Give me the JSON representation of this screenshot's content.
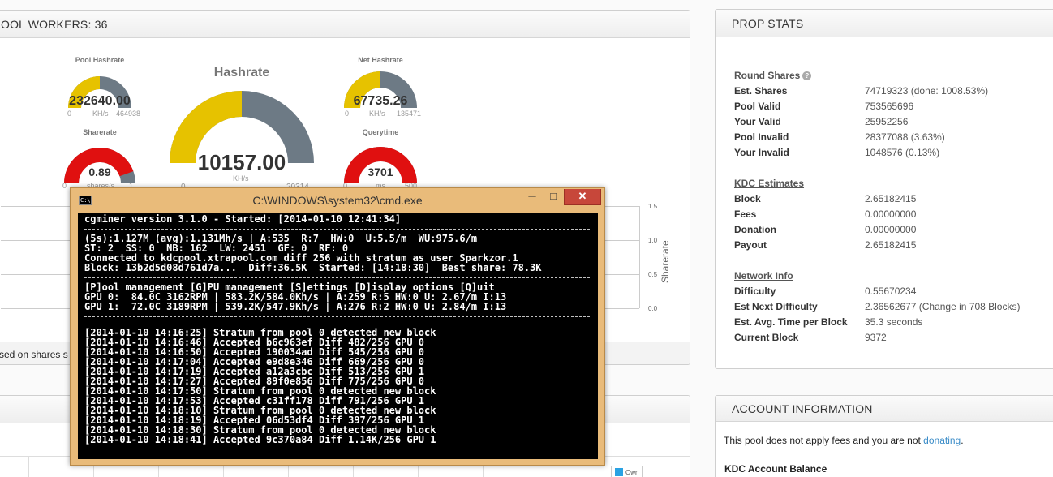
{
  "workers_panel": {
    "title": "OOL WORKERS: 36",
    "footer_text": "sed on shares s"
  },
  "gauges": {
    "pool_hashrate": {
      "title": "Pool Hashrate",
      "value": "232640.00",
      "min": "0",
      "unit": "KH/s",
      "max": "464938",
      "fraction": 0.5
    },
    "hashrate": {
      "title": "Hashrate",
      "value": "10157.00",
      "min": "0",
      "unit": "KH/s",
      "max": "20314",
      "fraction": 0.5
    },
    "net_hashrate": {
      "title": "Net Hashrate",
      "value": "67735.26",
      "min": "0",
      "unit": "KH/s",
      "max": "135471",
      "fraction": 0.5
    },
    "sharerate": {
      "title": "Sharerate",
      "value": "0.89",
      "min": "0",
      "unit": "shares/s",
      "max": "1",
      "fraction": 0.89
    },
    "querytime": {
      "title": "Querytime",
      "value": "3701",
      "min": "0",
      "unit": "ms",
      "max": "500",
      "fraction": 1.0
    }
  },
  "sharerate_chart": {
    "ylabel": "Sharerate",
    "ticks": [
      "1.5",
      "1.0",
      "0.5",
      "0.0"
    ]
  },
  "own_legend": "Own",
  "prop_stats": {
    "title": "PROP STATS",
    "round_shares": {
      "heading": "Round Shares",
      "rows": [
        {
          "label": "Est. Shares",
          "value": "74719323 (done: 1008.53%)"
        },
        {
          "label": "Pool Valid",
          "value": "753565696"
        },
        {
          "label": "Your Valid",
          "value": "25952256"
        },
        {
          "label": "Pool Invalid",
          "value": "28377088 (3.63%)"
        },
        {
          "label": "Your Invalid",
          "value": "1048576 (0.13%)"
        }
      ]
    },
    "kdc_estimates": {
      "heading": "KDC Estimates",
      "rows": [
        {
          "label": "Block",
          "value": "2.65182415"
        },
        {
          "label": "Fees",
          "value": "0.00000000"
        },
        {
          "label": "Donation",
          "value": "0.00000000"
        },
        {
          "label": "Payout",
          "value": "2.65182415"
        }
      ]
    },
    "network_info": {
      "heading": "Network Info",
      "rows": [
        {
          "label": "Difficulty",
          "value": "0.55670234"
        },
        {
          "label": "Est Next Difficulty",
          "value": "2.36562677 (Change in 708 Blocks)"
        },
        {
          "label": "Est. Avg. Time per Block",
          "value": "35.3 seconds"
        },
        {
          "label": "Current Block",
          "value": "9372"
        }
      ]
    }
  },
  "account": {
    "title": "ACCOUNT INFORMATION",
    "fee_text": "This pool does not apply fees and you are not ",
    "fee_link": "donating",
    "fee_end": ".",
    "balance_label": "KDC Account Balance"
  },
  "cmd": {
    "title": "C:\\WINDOWS\\system32\\cmd.exe",
    "header": "cgminer version 3.1.0 - Started: [2014-01-10 12:41:34]",
    "status": [
      "(5s):1.127M (avg):1.131Mh/s | A:535  R:7  HW:0  U:5.5/m  WU:975.6/m",
      "ST: 2  SS: 0  NB: 162  LW: 2451  GF: 0  RF: 0",
      "Connected to kdcpool.xtrapool.com diff 256 with stratum as user Sparkzor.1",
      "Block: 13b2d5d08d761d7a...  Diff:36.5K  Started: [14:18:30]  Best share: 78.3K"
    ],
    "menu": [
      "[P]ool management [G]PU management [S]ettings [D]isplay options [Q]uit",
      "GPU 0:  84.0C 3162RPM | 583.2K/584.0Kh/s | A:259 R:5 HW:0 U: 2.67/m I:13",
      "GPU 1:  72.0C 3189RPM | 539.2K/547.9Kh/s | A:276 R:2 HW:0 U: 2.84/m I:13"
    ],
    "log": [
      "[2014-01-10 14:16:25] Stratum from pool 0 detected new block",
      "[2014-01-10 14:16:46] Accepted b6c963ef Diff 482/256 GPU 0",
      "[2014-01-10 14:16:50] Accepted 190034ad Diff 545/256 GPU 0",
      "[2014-01-10 14:17:04] Accepted e9d8e346 Diff 669/256 GPU 0",
      "[2014-01-10 14:17:19] Accepted a12a3cbc Diff 513/256 GPU 1",
      "[2014-01-10 14:17:27] Accepted 89f0e856 Diff 775/256 GPU 0",
      "[2014-01-10 14:17:50] Stratum from pool 0 detected new block",
      "[2014-01-10 14:17:53] Accepted c31ff178 Diff 791/256 GPU 1",
      "[2014-01-10 14:18:10] Stratum from pool 0 detected new block",
      "[2014-01-10 14:18:19] Accepted 06d53df4 Diff 397/256 GPU 1",
      "[2014-01-10 14:18:30] Stratum from pool 0 detected new block",
      "[2014-01-10 14:18:41] Accepted 9c370a84 Diff 1.14K/256 GPU 1"
    ]
  },
  "colors": {
    "gauge_fill_yellow": "#e6c200",
    "gauge_fill_red": "#e01010",
    "gauge_bg": "#6d7a85",
    "cmd_frame": "#e9bb7a",
    "close_button": "#c7473a"
  }
}
